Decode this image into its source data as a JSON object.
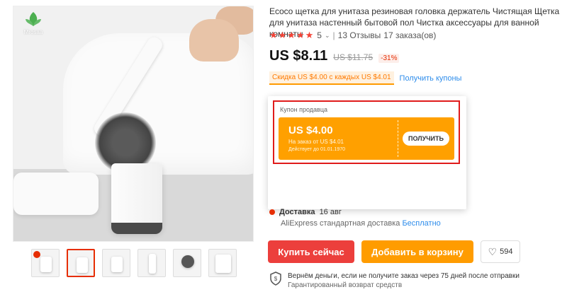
{
  "brand": {
    "logo_text": "Mrosaa"
  },
  "product": {
    "title": "Ecoco щетка для унитаза резиновая головка держатель Чистящая Щетка для унитаза настенный бытовой пол Чистка аксессуары для ванной комнаты",
    "rating_value": "5",
    "reviews": "13 Отзывы",
    "orders": "17 заказа(ов)",
    "price": "US $8.11",
    "old_price": "US $11.75",
    "discount": "-31%"
  },
  "coupons": {
    "tag": "Скидка US $4.00 с каждых US $4.01",
    "link": "Получить купоны",
    "popup_label": "Купон продавца",
    "card": {
      "amount": "US $4.00",
      "condition": "На заказ от US $4.01",
      "validity": "Действует до 01.01.1970",
      "button": "ПОЛУЧИТЬ"
    }
  },
  "delivery": {
    "label": "Доставка",
    "date": "16 авг",
    "service": "AliExpress стандартная доставка",
    "cost": "Бесплатно"
  },
  "actions": {
    "buy_now": "Купить сейчас",
    "add_to_cart": "Добавить в корзину",
    "wishlist_count": "594"
  },
  "guarantee": {
    "line1": "Вернём деньги, если не получите заказ через 75 дней после отправки",
    "line2": "Гарантированный возврат средств"
  },
  "colors": {
    "accent_red": "#ec3f3c",
    "accent_orange": "#ff9c00",
    "coupon_orange": "#ffa000",
    "link_blue": "#2d8ceb",
    "highlight_frame": "#e01b1b"
  }
}
